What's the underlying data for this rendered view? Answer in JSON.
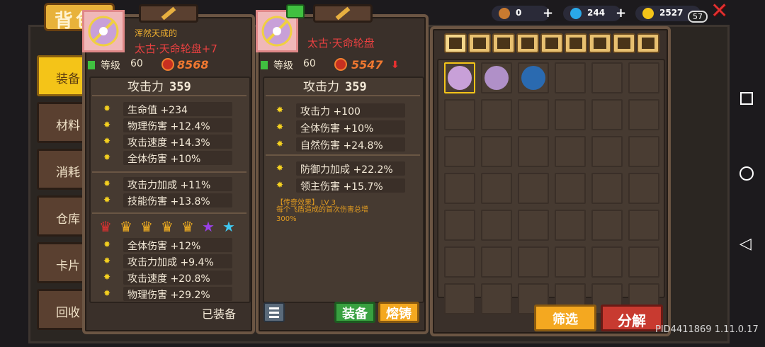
{
  "title": "背包",
  "sidebar": [
    "装备",
    "材料",
    "消耗",
    "仓库",
    "卡片",
    "回收"
  ],
  "currencies": [
    {
      "name": "key-icon",
      "value": "0",
      "color": "#c87a30"
    },
    {
      "name": "gem-icon",
      "value": "244",
      "color": "#2aa8e8"
    },
    {
      "name": "gold-coin-icon",
      "value": "2527",
      "color": "#f4c418"
    }
  ],
  "badge": "57",
  "left_item": {
    "prefix": "浑然天成的",
    "name": "太古·天命轮盘+7",
    "level_label": "等级",
    "level": "60",
    "power": "8568",
    "attack_label": "攻击力",
    "attack": "359",
    "stats_a": [
      "生命值 +234",
      "物理伤害 +12.4%",
      "攻击速度 +14.3%",
      "全体伤害 +10%"
    ],
    "stats_b": [
      "攻击力加成 +11%",
      "技能伤害 +13.8%"
    ],
    "crown_colors": [
      "#e03030",
      "#f4b020",
      "#f4b020",
      "#f4b020",
      "#f4b020"
    ],
    "star_colors": [
      "#9a40e8",
      "#40c8f0"
    ],
    "stats_c": [
      "全体伤害 +12%",
      "攻击力加成 +9.4%",
      "攻击速度 +20.8%",
      "物理伤害 +29.2%"
    ],
    "equipped": "已装备"
  },
  "right_item": {
    "name": "太古·天命轮盘",
    "level_label": "等级",
    "level": "60",
    "power": "5547",
    "attack_label": "攻击力",
    "attack": "359",
    "stats_a": [
      "攻击力 +100",
      "全体伤害 +10%",
      "自然伤害 +24.8%"
    ],
    "stats_b": [
      "防御力加成 +22.2%",
      "领主伤害 +15.7%"
    ],
    "legend_title": "【传奇效果】 LV 3",
    "legend_text1": "每个飞盾造成的首次伤害总增",
    "legend_text2": "300%",
    "equip_button": "装备",
    "smelt_button": "熔铸"
  },
  "inventory": {
    "filter_button": "筛选",
    "decompose_button": "分解"
  },
  "version": "PID4411869 1.11.0.17"
}
